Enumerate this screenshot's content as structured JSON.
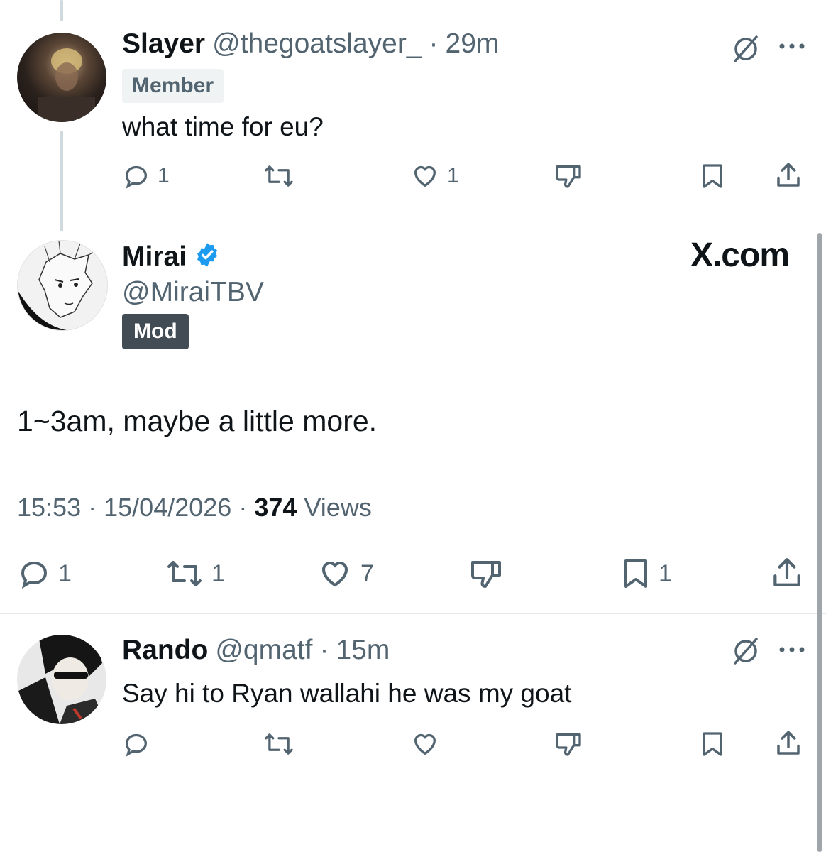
{
  "slayer": {
    "name": "Slayer",
    "handle": "@thegoatslayer_",
    "time": "29m",
    "badge": "Member",
    "text": "what time for eu?",
    "replies": "1",
    "likes": "1"
  },
  "mirai": {
    "name": "Mirai",
    "handle": "@MiraiTBV",
    "badge": "Mod",
    "text": "1~3am, maybe a little more.",
    "time": "15:53",
    "date": "15/04/2026",
    "views_count": "374",
    "views_label": "Views",
    "replies": "1",
    "reposts": "1",
    "likes": "7",
    "bookmarks": "1",
    "watermark": "X.com"
  },
  "rando": {
    "name": "Rando",
    "handle": "@qmatf",
    "time": "15m",
    "text": "Say hi to Ryan wallahi he was my goat"
  },
  "separator": "·",
  "colors": {
    "verified": "#1d9bf0",
    "muted": "#536471",
    "text": "#0f1419",
    "mod_badge": "#424c55"
  },
  "icons": [
    "grok-icon",
    "more-icon",
    "reply-icon",
    "repost-icon",
    "like-icon",
    "dislike-icon",
    "bookmark-icon",
    "share-icon",
    "verified-icon"
  ]
}
